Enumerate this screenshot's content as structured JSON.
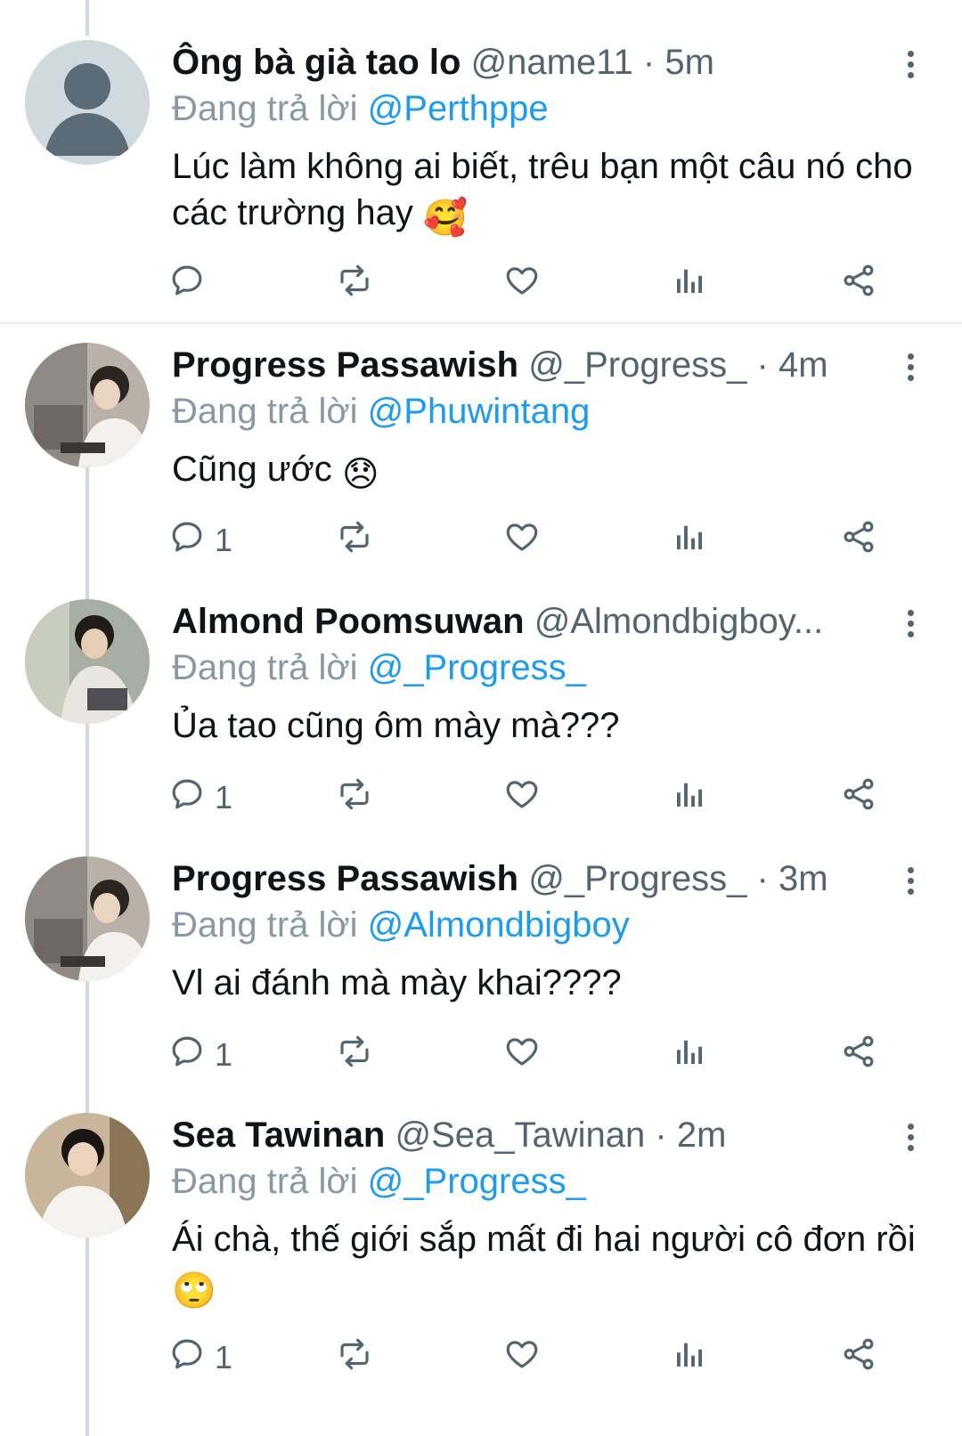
{
  "tweets": [
    {
      "name": "Ông bà già tao lo",
      "handle": "@name11",
      "time": "5m",
      "replying_prefix": "Đang trả lời",
      "replying_to": "@Perthppe",
      "text": "Lúc làm không ai biết, trêu bạn một câu nó cho các trường hay",
      "emoji": "🥰",
      "replies": ""
    },
    {
      "name": "Progress Passawish",
      "handle": "@_Progress_",
      "time": "4m",
      "replying_prefix": "Đang trả lời",
      "replying_to": "@Phuwintang",
      "text": "Cũng ước",
      "emoji": "😞",
      "replies": "1"
    },
    {
      "name": "Almond Poomsuwan",
      "handle": "@Almondbigboy...",
      "time": "",
      "replying_prefix": "Đang trả lời",
      "replying_to": "@_Progress_",
      "text": "Ủa tao cũng ôm mày mà???",
      "emoji": "",
      "replies": "1"
    },
    {
      "name": "Progress Passawish",
      "handle": "@_Progress_",
      "time": "3m",
      "replying_prefix": "Đang trả lời",
      "replying_to": "@Almondbigboy",
      "text": "Vl ai đánh mà mày khai????",
      "emoji": "",
      "replies": "1"
    },
    {
      "name": "Sea Tawinan",
      "handle": "@Sea_Tawinan",
      "time": "2m",
      "replying_prefix": "Đang trả lời",
      "replying_to": "@_Progress_",
      "text": "Ái chà, thế giới sắp mất đi hai người cô đơn rồi",
      "emoji": "🙄",
      "replies": "1"
    }
  ],
  "icons": {
    "reply": "reply-icon",
    "retweet": "retweet-icon",
    "like": "heart-icon",
    "analytics": "analytics-icon",
    "share": "share-icon",
    "more": "more-vertical-icon"
  },
  "colors": {
    "accent": "#1d9bf0",
    "text": "#0f1419",
    "secondary": "#536471",
    "thread_line": "#cfd9de"
  }
}
